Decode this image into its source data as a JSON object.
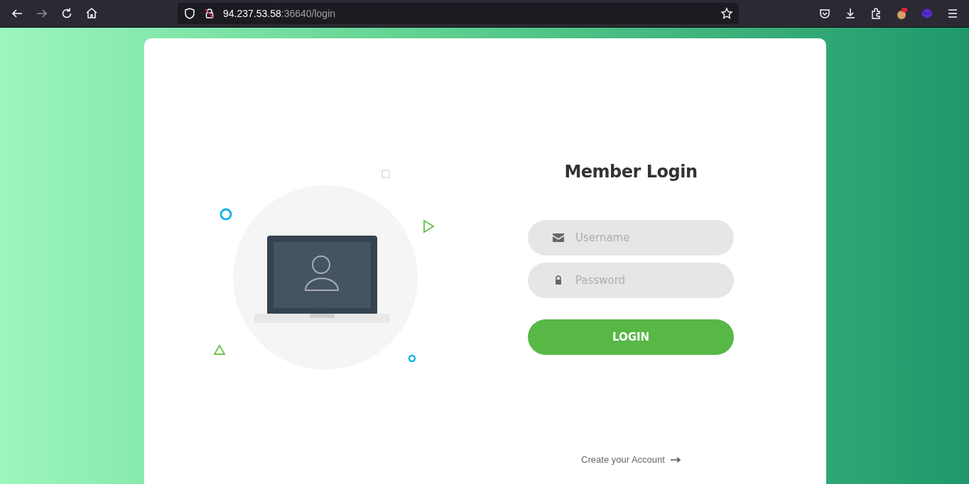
{
  "browser": {
    "url": {
      "host": "94.237.53.58",
      "path": ":36640/login"
    }
  },
  "login": {
    "title": "Member Login",
    "fields": [
      {
        "kind": "email",
        "placeholder": "Username"
      },
      {
        "kind": "password",
        "placeholder": "Password"
      }
    ],
    "button": "LOGIN",
    "create_account_link": "Create your Account"
  }
}
